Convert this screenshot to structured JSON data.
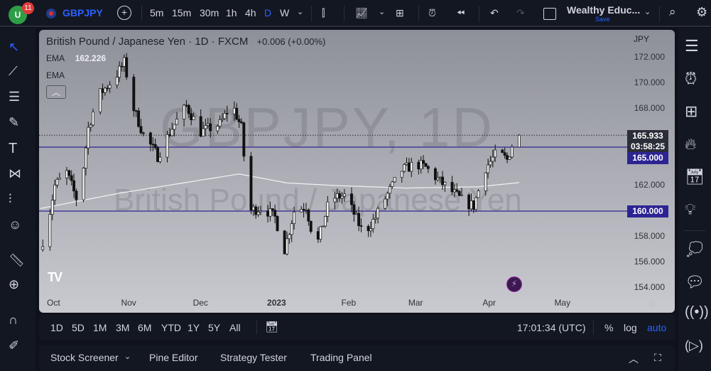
{
  "topbar": {
    "notifications": "11",
    "symbol": "GBPJPY",
    "intervals": [
      "5m",
      "15m",
      "30m",
      "1h",
      "4h",
      "D",
      "W"
    ],
    "active_interval": "D",
    "layout_name": "Wealthy Educ...",
    "save_label": "Save"
  },
  "legend": {
    "title": "British Pound / Japanese Yen",
    "interval": "1D",
    "exchange": "FXCM",
    "change": "+0.006 (+0.00%)",
    "ema1_label": "EMA",
    "ema1_value": "162.226",
    "ema2_label": "EMA",
    "ema2_value": "• • •"
  },
  "watermark": {
    "line1": "GBPJPY, 1D",
    "line2": "British Pound / Japanese Yen"
  },
  "price_axis": {
    "currency": "JPY",
    "last_price": "165.933",
    "countdown": "03:58:25",
    "level1": "165.000",
    "level2": "160.000"
  },
  "time_bar": {
    "ranges": [
      "1D",
      "5D",
      "1M",
      "3M",
      "6M",
      "YTD",
      "1Y",
      "5Y",
      "All"
    ],
    "clock": "17:01:34 (UTC)",
    "percent": "%",
    "log": "log",
    "auto": "auto"
  },
  "bottom_panel": {
    "tabs": [
      "Stock Screener",
      "Pine Editor",
      "Strategy Tester",
      "Trading Panel"
    ]
  },
  "chart_data": {
    "type": "candlestick",
    "symbol": "GBPJPY",
    "interval": "1D",
    "ylim": [
      153,
      173
    ],
    "yticks": [
      "172.000",
      "170.000",
      "168.000",
      "162.000",
      "158.000",
      "156.000",
      "154.000"
    ],
    "yticks_values": [
      172,
      170,
      168,
      162,
      158,
      156,
      154
    ],
    "xticks": [
      "Oct",
      "Nov",
      "Dec",
      "2023",
      "Feb",
      "Mar",
      "Apr",
      "May"
    ],
    "xticks_day": [
      0,
      31,
      61,
      92,
      123,
      151,
      182,
      212
    ],
    "horizontal_lines": [
      165,
      160
    ],
    "last_price": 165.933,
    "price_path_day_close": [
      [
        -3,
        157
      ],
      [
        0,
        159
      ],
      [
        3,
        162
      ],
      [
        8,
        163
      ],
      [
        13,
        160.5
      ],
      [
        17,
        166.5
      ],
      [
        21,
        169
      ],
      [
        28,
        170.4
      ],
      [
        32,
        171.6
      ],
      [
        36,
        168
      ],
      [
        40,
        166
      ],
      [
        46,
        164.3
      ],
      [
        52,
        166.5
      ],
      [
        58,
        168.2
      ],
      [
        64,
        166.2
      ],
      [
        72,
        166.8
      ],
      [
        77,
        168.4
      ],
      [
        81,
        166.5
      ],
      [
        84,
        160
      ],
      [
        90,
        160.3
      ],
      [
        95,
        159.5
      ],
      [
        99,
        157
      ],
      [
        103,
        160
      ],
      [
        108,
        160.4
      ],
      [
        112,
        157
      ],
      [
        118,
        161
      ],
      [
        124,
        161.2
      ],
      [
        128,
        159.8
      ],
      [
        132,
        158.2
      ],
      [
        137,
        159.5
      ],
      [
        141,
        161
      ],
      [
        148,
        163.2
      ],
      [
        154,
        163.7
      ],
      [
        158,
        163.4
      ],
      [
        164,
        162.3
      ],
      [
        169,
        161.5
      ],
      [
        174,
        160.7
      ],
      [
        178,
        160.4
      ],
      [
        183,
        163.4
      ],
      [
        188,
        164.6
      ],
      [
        192,
        164
      ],
      [
        195,
        165.7
      ],
      [
        197,
        165.93
      ]
    ],
    "ema200_day_value": [
      [
        -3,
        160.2
      ],
      [
        30,
        161.4
      ],
      [
        60,
        162.3
      ],
      [
        80,
        162.9
      ],
      [
        100,
        162.2
      ],
      [
        120,
        162
      ],
      [
        150,
        161.8
      ],
      [
        180,
        161.9
      ],
      [
        197,
        162.23
      ]
    ]
  }
}
